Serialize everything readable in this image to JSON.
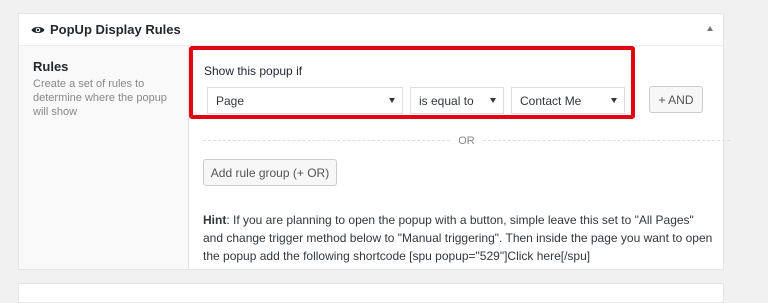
{
  "metabox": {
    "title": "PopUp Display Rules",
    "title_icon": "eye-icon",
    "toggle_icon": "arrow-up-icon"
  },
  "rules": {
    "label": "Rules",
    "description": "Create a set of rules to determine where the popup will show"
  },
  "rule_group": {
    "title": "Show this popup if",
    "highlight_color": "#e20613",
    "param_select": "Page",
    "operator_select": "is equal to",
    "value_select": "Contact Me",
    "and_button": "+ AND"
  },
  "or_label": "OR",
  "add_rule_group_button": "Add rule group (+ OR)",
  "hint": {
    "label": "Hint",
    "text": ": If you are planning to open the popup with a button, simple leave this set to \"All Pages\" and change trigger method below to \"Manual triggering\". Then inside the page you want to open the popup add the following shortcode [spu popup=\"529\"]Click here[/spu]"
  }
}
